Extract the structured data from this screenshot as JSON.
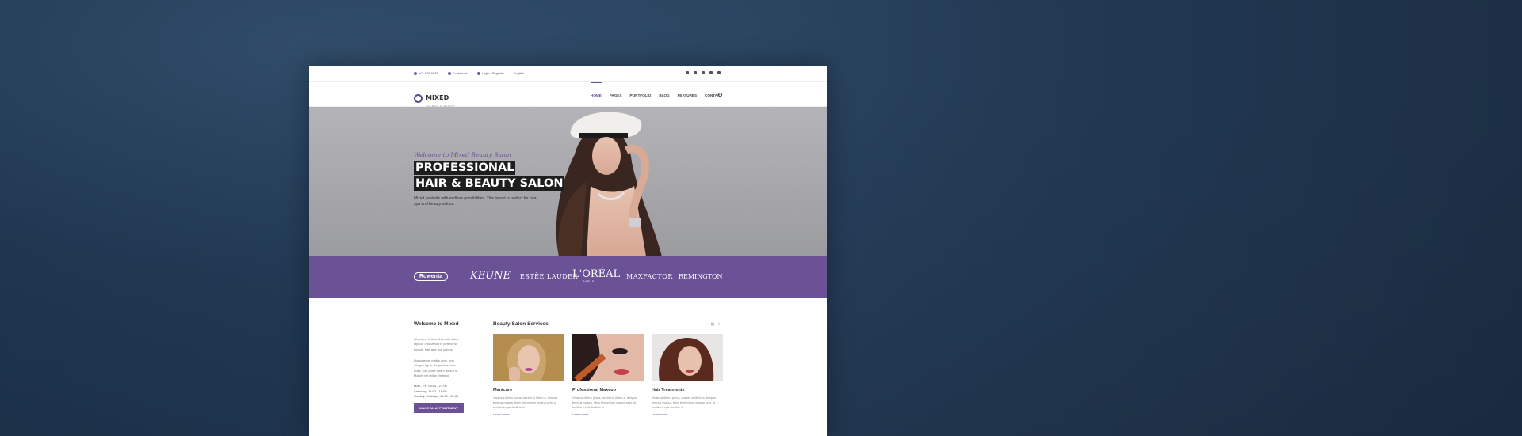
{
  "topbar": {
    "phone": "+01 008 5638",
    "contact": "Contact us",
    "login": "Login / Register",
    "language": "English",
    "social_icons": [
      "facebook-icon",
      "instagram-icon",
      "twitter-icon",
      "linkedin-icon",
      "skype-icon"
    ]
  },
  "brand": {
    "name": "MIXED",
    "tagline": "THE BEST IN BEAUTY"
  },
  "nav": {
    "items": [
      "HOME",
      "PAGES",
      "PORTFOLIO",
      "BLOG",
      "FEATURES",
      "CONTACT"
    ],
    "active": "HOME"
  },
  "hero": {
    "welcome": "Welcome to Mixed Beauty Salon",
    "title_line1": "PROFESSIONAL",
    "title_line2": "HAIR & BEAUTY SALON",
    "description": "Mixed, website with endless possibilities. This layout is perfect for hair, spa and beauty salons."
  },
  "brands": {
    "rowenta": "Rowenta",
    "keune": "KEUNE",
    "estee": "ESTĒE LAUDER",
    "loreal": "L'ORÉAL",
    "loreal_sub": "PARIS",
    "maxfactor": "MAXFACTOR",
    "remington": "REMINGTON"
  },
  "welcome": {
    "title": "Welcome to Mixed",
    "p1": "Welcome to Mixed beauty salon layout. This layout is perfect for beauty, hair and spa salons.",
    "p2": "Quisque vel mattis ante, non congue ligula. In gravida nunc nulla, non porta lorem auctor id. Mauris vel tellus eleifend.",
    "hours": [
      "Mon - Fri: 08:00 - 21:00",
      "Saturday: 11:00 - 19:00",
      "Sunday, Holidays: 11:00 - 20:00"
    ],
    "button": "MAKE AN APPOINTMENT"
  },
  "services": {
    "title": "Beauty Salon Services",
    "cards": [
      {
        "name": "Manicure",
        "text": "Vivamus libero purus, laoreet in libero a, tempus tempus massa. Nam fermentum magna sem, id facilisis turpis facilisis in.",
        "more": "Learn more"
      },
      {
        "name": "Professional Makeup",
        "text": "Vivamus libero purus, laoreet in libero a, tempus tempus massa. Nam fermentum magna sem, id facilisis turpis facilisis in.",
        "more": "Learn more"
      },
      {
        "name": "Hair Treatments",
        "text": "Vivamus libero purus, laoreet in libero a, tempus tempus massa. Nam fermentum magna sem, id facilisis turpis facilisis in.",
        "more": "Learn more"
      }
    ]
  },
  "colors": {
    "accent": "#6b5196",
    "dark": "#1e1e1e",
    "background": "#22384f"
  }
}
